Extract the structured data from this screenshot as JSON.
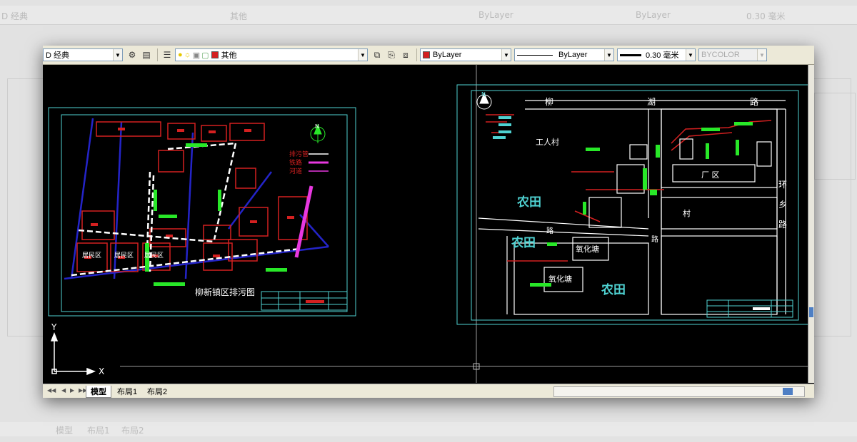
{
  "toolbar": {
    "workspace": "D 经典",
    "layer_name": "其他",
    "color": "ByLayer",
    "linetype": "ByLayer",
    "lineweight": "0.30 毫米",
    "plotstyle": "BYCOLOR"
  },
  "left_drawing": {
    "title": "柳新镇区排污图",
    "legend": [
      "排污管",
      "铁路",
      "河道"
    ],
    "north": "N",
    "zones": [
      "居民区",
      "居民区",
      "居民区"
    ]
  },
  "right_drawing": {
    "north": "N",
    "road_top": [
      "柳",
      "湖",
      "路"
    ],
    "road_right": [
      "环",
      "乡",
      "路"
    ],
    "road_mid": "路",
    "road_mid2": "路",
    "farmland": [
      "农田",
      "农田",
      "农田"
    ],
    "village": "工人村",
    "factory": "厂 区",
    "village2": "村",
    "oxidation_ponds": [
      "氧化塘",
      "氧化塘"
    ]
  },
  "axes": {
    "y": "Y",
    "x": "X"
  },
  "tabs": {
    "model": "模型",
    "layout1": "布局1",
    "layout2": "布局2"
  },
  "ghost": {
    "workspace": "D 经典",
    "layer": "其他",
    "color": "ByLayer",
    "linetype": "ByLayer",
    "lineweight": "0.30 毫米",
    "tab_model": "模型",
    "tab_layout1": "布局1",
    "tab_layout2": "布局2"
  },
  "colors": {
    "canvas": "#000000",
    "frame": "#4fd2d2",
    "building": "#d42020",
    "pipe": "#ffffff",
    "green": "#28e828",
    "road": "#2424c8",
    "magenta": "#e838e0"
  }
}
